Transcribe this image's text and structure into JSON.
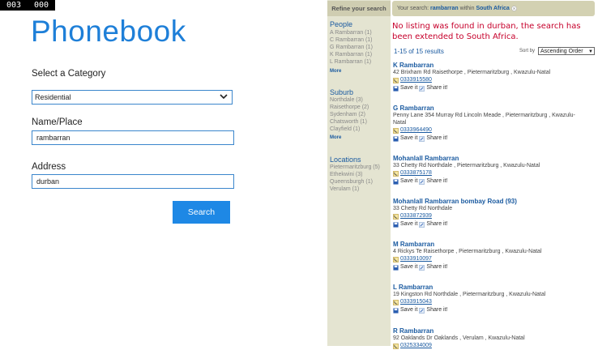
{
  "counter": {
    "a": "003",
    "b": "000"
  },
  "app": {
    "title": "Phonebook"
  },
  "form": {
    "category_label": "Select a Category",
    "category_value": "Residential",
    "name_label": "Name/Place",
    "name_value": "rambarran",
    "address_label": "Address",
    "address_value": "durban",
    "search_label": "Search"
  },
  "refine": {
    "heading": "Refine your search",
    "your_search_prefix": "Your search:",
    "your_search_term": "rambarran",
    "your_search_within": "within",
    "your_search_region": "South Africa"
  },
  "facets": {
    "people": {
      "title": "People",
      "items": [
        "A Rambarran (1)",
        "C Rambarran (1)",
        "G Rambarran (1)",
        "K Rambarran (1)",
        "L Rambarran (1)"
      ],
      "more": "More"
    },
    "suburb": {
      "title": "Suburb",
      "items": [
        "Northdale (3)",
        "Raisethorpe (2)",
        "Sydenham (2)",
        "Chatsworth (1)",
        "Clayfield (1)"
      ],
      "more": "More"
    },
    "locations": {
      "title": "Locations",
      "items": [
        "Pietermaritzburg (5)",
        "Ethekwini (3)",
        "Queensburgh (1)",
        "Verulam (1)"
      ]
    }
  },
  "results": {
    "notice": "No listing was found in durban, the search has been extended to South Africa.",
    "count": "1-15 of 15 results",
    "sort_label": "Sort by",
    "sort_value": "Ascending Order",
    "save_label": "Save it",
    "share_label": "Share it!",
    "items": [
      {
        "name": "K Rambarran",
        "addr": "42 Brixham Rd Raisethorpe , Pietermaritzburg , Kwazulu-Natal",
        "phone": "0333915580"
      },
      {
        "name": "G Rambarran",
        "addr": "Penny Lane 354 Murray Rd Lincoln Meade , Pietermaritzburg , Kwazulu-Natal",
        "phone": "0333964490"
      },
      {
        "name": "Mohanlall Rambarran",
        "addr": "33 Chetty Rd Northdale , Pietermaritzburg , Kwazulu-Natal",
        "phone": "0333875178"
      },
      {
        "name": "Mohanlall Rambarran bombay Road (93)",
        "addr": "33 Chetty Rd Northdale",
        "phone": "0333872939"
      },
      {
        "name": "M Rambarran",
        "addr": "4 Rickys Te Raisethorpe , Pietermaritzburg , Kwazulu-Natal",
        "phone": "0333910097"
      },
      {
        "name": "L Rambarran",
        "addr": "19 Kingston Rd Northdale , Pietermaritzburg , Kwazulu-Natal",
        "phone": "0333915043"
      },
      {
        "name": "R Rambarran",
        "addr": "92 Oaklands Dr Oaklands , Verulam , Kwazulu-Natal",
        "phone": "0325334009"
      }
    ]
  }
}
